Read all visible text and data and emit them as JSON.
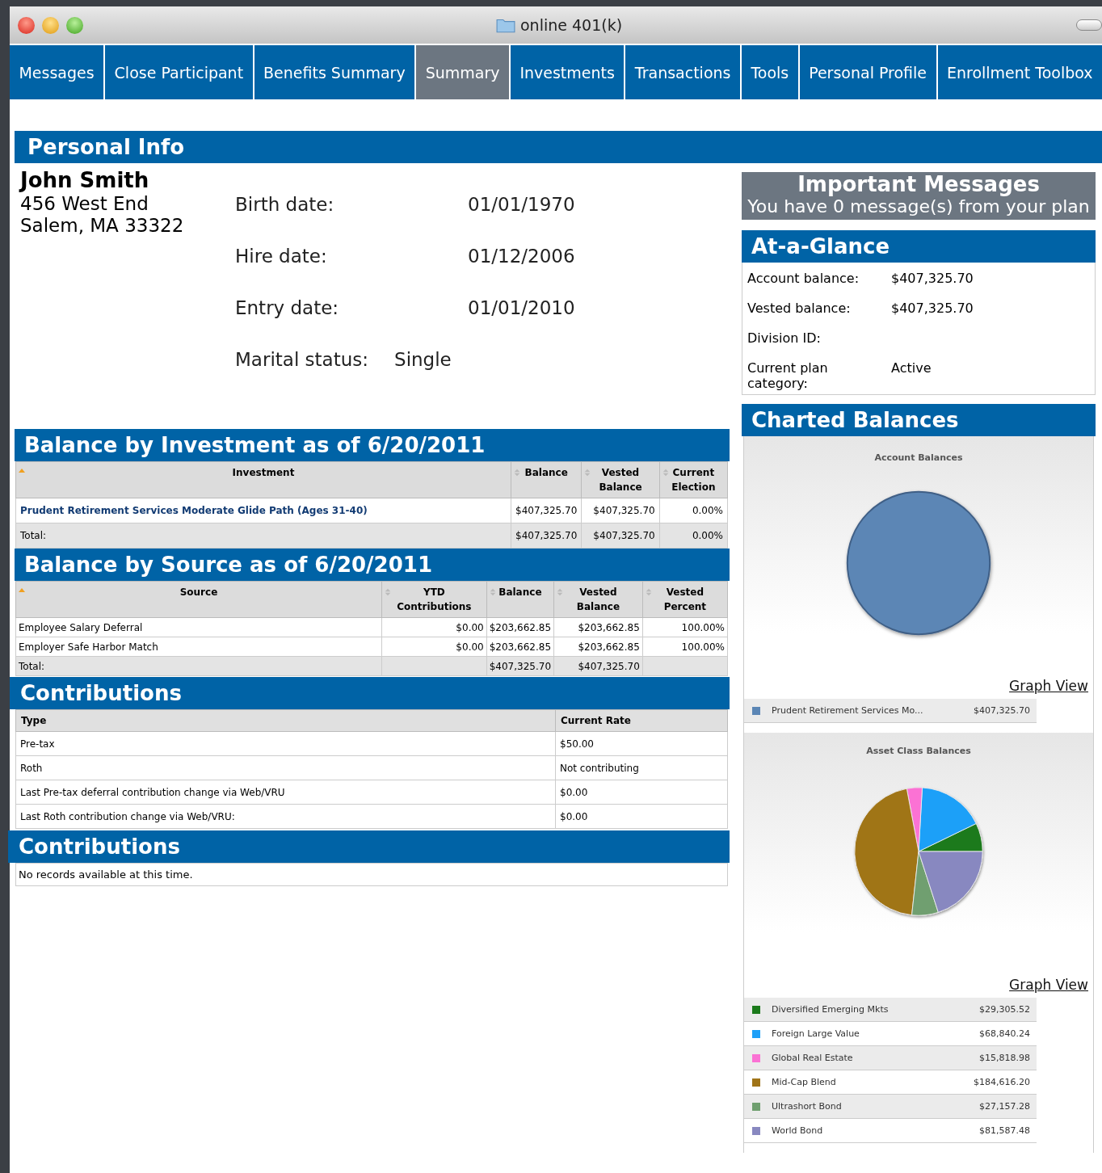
{
  "window": {
    "title": "online 401(k)"
  },
  "tabs": [
    {
      "label": "Messages",
      "selected": false
    },
    {
      "label": "Close Participant",
      "selected": false
    },
    {
      "label": "Benefits Summary",
      "selected": false
    },
    {
      "label": "Summary",
      "selected": true
    },
    {
      "label": "Investments",
      "selected": false
    },
    {
      "label": "Transactions",
      "selected": false
    },
    {
      "label": "Tools",
      "selected": false
    },
    {
      "label": "Personal Profile",
      "selected": false
    },
    {
      "label": "Enrollment Toolbox",
      "selected": false
    }
  ],
  "personal_info": {
    "heading": "Personal Info",
    "name": "John Smith",
    "address": [
      "456 West End",
      "Salem, MA 33322"
    ],
    "fields": [
      {
        "label": "Birth date:",
        "value": "01/01/1970"
      },
      {
        "label": "Hire date:",
        "value": "01/12/2006"
      },
      {
        "label": "Entry date:",
        "value": "01/01/2010"
      }
    ],
    "marital_status": {
      "label": "Marital status:",
      "value": "Single"
    }
  },
  "important_messages": {
    "title": "Important Messages",
    "text": "You have 0 message(s) from your plan"
  },
  "at_a_glance": {
    "heading": "At-a-Glance",
    "rows": [
      {
        "label": "Account balance:",
        "value": "$407,325.70"
      },
      {
        "label": "Vested balance:",
        "value": "$407,325.70"
      },
      {
        "label": "Division ID:"
      },
      {
        "label": "Current plan category:",
        "value": "Active"
      }
    ]
  },
  "balance_by_investment": {
    "heading": "Balance by Investment as of 6/20/2011",
    "columns": [
      {
        "label": "Investment",
        "sorted": true
      },
      {
        "label": "Balance",
        "sorted": false
      },
      {
        "label": "Vested Balance",
        "sorted": false
      },
      {
        "label": "Current Election",
        "sorted": false
      }
    ],
    "rows": [
      {
        "link": true,
        "cells": [
          "Prudent Retirement Services Moderate Glide Path (Ages 31-40)",
          "$407,325.70",
          "$407,325.70",
          "0.00%"
        ]
      }
    ],
    "total": [
      {
        "kind": "text",
        "text": "Total:"
      },
      {
        "kind": "text",
        "text": "$407,325.70"
      },
      {
        "kind": "text",
        "text": "$407,325.70"
      },
      {
        "kind": "text",
        "text": "0.00%"
      }
    ]
  },
  "balance_by_source": {
    "heading": "Balance by Source as of 6/20/2011",
    "columns": [
      {
        "label": "Source",
        "sorted": true
      },
      {
        "label": "YTD Contributions",
        "sorted": false
      },
      {
        "label": "Balance",
        "sorted": false
      },
      {
        "label": "Vested Balance",
        "sorted": false
      },
      {
        "label": "Vested Percent",
        "sorted": false
      }
    ],
    "rows": [
      {
        "link": false,
        "cells": [
          "Employee Salary Deferral",
          "$0.00",
          "$203,662.85",
          "$203,662.85",
          "100.00%"
        ]
      },
      {
        "link": false,
        "cells": [
          "Employer Safe Harbor Match",
          "$0.00",
          "$203,662.85",
          "$203,662.85",
          "100.00%"
        ]
      }
    ],
    "total": [
      {
        "kind": "text",
        "text": "Total:"
      },
      {
        "kind": "empty"
      },
      {
        "kind": "text",
        "text": "$407,325.70"
      },
      {
        "kind": "text",
        "text": "$407,325.70"
      },
      {
        "kind": "empty"
      }
    ]
  },
  "contributions": {
    "heading": "Contributions",
    "columns": [
      "Type",
      "Current Rate"
    ],
    "rows": [
      [
        "Pre-tax",
        "$50.00"
      ],
      [
        "Roth",
        "Not contributing"
      ],
      [
        "Last Pre-tax deferral contribution change via Web/VRU",
        "$0.00"
      ],
      [
        "Last Roth contribution change via Web/VRU:",
        "$0.00"
      ]
    ]
  },
  "contributions_2": {
    "heading": "Contributions",
    "message": "No records available at this time."
  },
  "charted_balances": {
    "heading": "Charted Balances",
    "charts": [
      {
        "link": "Graph View",
        "chart_data": {
          "type": "pie",
          "title": "Account Balances",
          "categories": [
            "Prudent Retirement Services Mo..."
          ],
          "values": [
            100
          ],
          "colors": [
            "#5b86b5"
          ]
        },
        "legend_values": [
          "$407,325.70"
        ]
      },
      {
        "link": "Graph View",
        "chart_data": {
          "type": "pie",
          "title": "Asset Class Balances",
          "categories": [
            "Diversified Emerging Mkts",
            "Foreign Large Value",
            "Global Real Estate",
            "Mid-Cap Blend",
            "Ultrashort Bond",
            "World Bond"
          ],
          "values": [
            7.19,
            16.9,
            3.88,
            45.33,
            6.67,
            20.03
          ],
          "colors": [
            "#1b7a1b",
            "#1ea0f8",
            "#fb72d4",
            "#a07418",
            "#6f9f6f",
            "#8888c0"
          ]
        },
        "legend_values": [
          "$29,305.52",
          "$68,840.24",
          "$15,818.98",
          "$184,616.20",
          "$27,157.28",
          "$81,587.48"
        ]
      }
    ]
  }
}
